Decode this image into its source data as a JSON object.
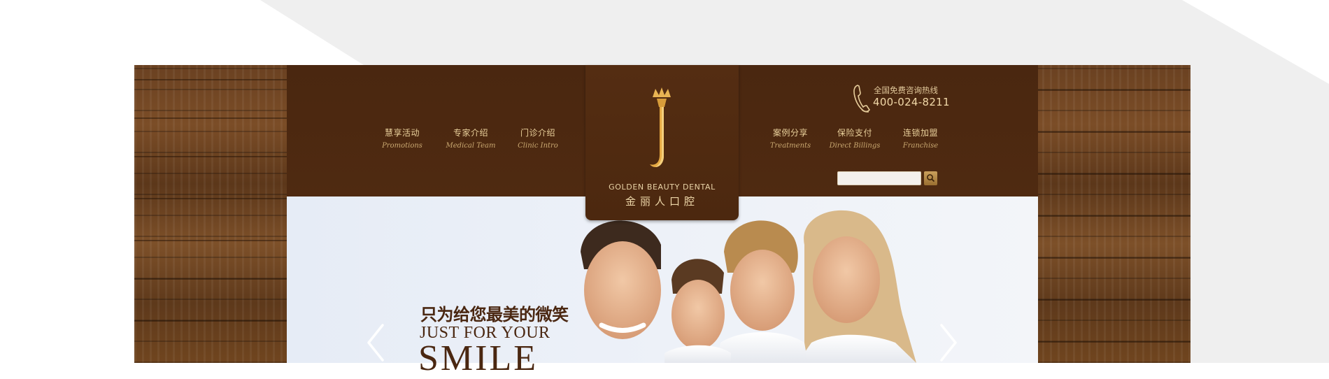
{
  "site": {
    "logo_en": "GOLDEN BEAUTY DENTAL",
    "logo_cn": "金丽人口腔"
  },
  "nav_left": [
    {
      "cn": "慧享活动",
      "en": "Promotions"
    },
    {
      "cn": "专家介绍",
      "en": "Medical Team"
    },
    {
      "cn": "门诊介绍",
      "en": "Clinic Intro"
    }
  ],
  "nav_right": [
    {
      "cn": "案例分享",
      "en": "Treatments"
    },
    {
      "cn": "保险支付",
      "en": "Direct Billings"
    },
    {
      "cn": "连锁加盟",
      "en": "Franchise"
    }
  ],
  "hotline": {
    "label": "全国免费咨询热线",
    "number": "400-024-8211"
  },
  "search": {
    "placeholder": ""
  },
  "hero": {
    "slogan_cn": "只为给您最美的微笑",
    "slogan_en_line1": "JUST FOR YOUR",
    "slogan_en_line2": "SMILE"
  },
  "icons": {
    "phone": "phone-icon",
    "search": "search-icon",
    "prev": "chevron-left-icon",
    "next": "chevron-right-icon",
    "logo": "crowned-j-logo"
  },
  "colors": {
    "header_brown": "#4f2a11",
    "gold_text": "#e8cf9a",
    "hero_bg": "#e9eef7",
    "slogan_brown": "#4a2711"
  }
}
